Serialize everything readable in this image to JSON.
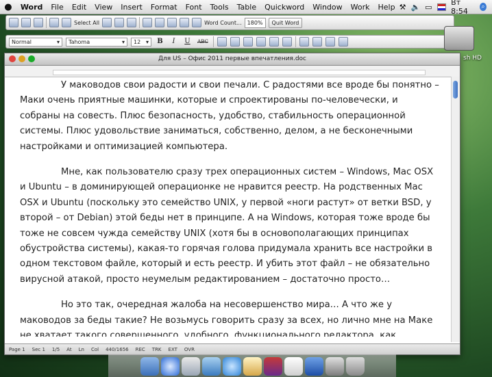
{
  "menubar": {
    "app": "Word",
    "items": [
      "File",
      "Edit",
      "View",
      "Insert",
      "Format",
      "Font",
      "Tools",
      "Table",
      "Quickword",
      "Window",
      "Work",
      "Help"
    ],
    "clock": "Вт 8:54"
  },
  "toolbar1": {
    "select_all": "Select All",
    "word_count": "Word Count...",
    "zoom": "180%",
    "quit_word": "Quit Word"
  },
  "toolbar2": {
    "style": "Normal",
    "font": "Tahoma",
    "size": "12",
    "bold": "B",
    "italic": "I",
    "underline": "U",
    "strike": "ABC"
  },
  "desktop": {
    "hd_label": "sh HD"
  },
  "window": {
    "title": "Для US – Офис 2011 первые впечатления.doc",
    "paragraphs": [
      "У маководов свои радости и свои печали. С радостями все вроде бы понятно – Маки очень приятные машинки, которые и спроектированы по-человечески, и собраны на совесть. Плюс безопасность, удобство, стабильность операционной системы. Плюс удовольствие заниматься, собственно, делом, а не бесконечными настройками и оптимизацией компьютера.",
      "Мне, как пользователю сразу трех операционных систем – Windows, Mac OSX и Ubuntu – в доминирующей операционке не нравится реестр. На родственных Mac OSX и Ubuntu (поскольку это семейство UNIX, у первой «ноги растут» от ветки BSD, у второй – от Debian) этой беды нет в принципе. А на Windows, которая тоже вроде бы тоже не совсем чужда семейству UNIX (хотя бы в основополагающих принципах обустройства системы), какая-то горячая голова придумала хранить все настройки в одном текстовом файле, который и есть реестр. И убить этот файл – не обязательно вирусной атакой, просто неумелым редактированием – достаточно просто…",
      "Но это так, очередная жалоба на несовершенство мира… А что же у маководов за беды такие? Не возьмусь говорить сразу за всех, но лично мне на Маке не хватает такого совершенного, удобного, функционального редактора, как"
    ]
  },
  "statusbar": {
    "page": "Page 1",
    "sec": "Sec 1",
    "pages": "1/5",
    "at": "At",
    "ln": "Ln",
    "col": "Col",
    "words": "440/1656",
    "rec": "REC",
    "trk": "TRK",
    "ext": "EXT",
    "ovr": "OVR"
  },
  "dock": {
    "icons": [
      "finder-icon",
      "safari-icon",
      "mail-icon",
      "photos-icon",
      "music-icon",
      "pen-icon",
      "books-icon",
      "paper-icon",
      "word-icon",
      "image-icon",
      "trash-icon"
    ]
  }
}
